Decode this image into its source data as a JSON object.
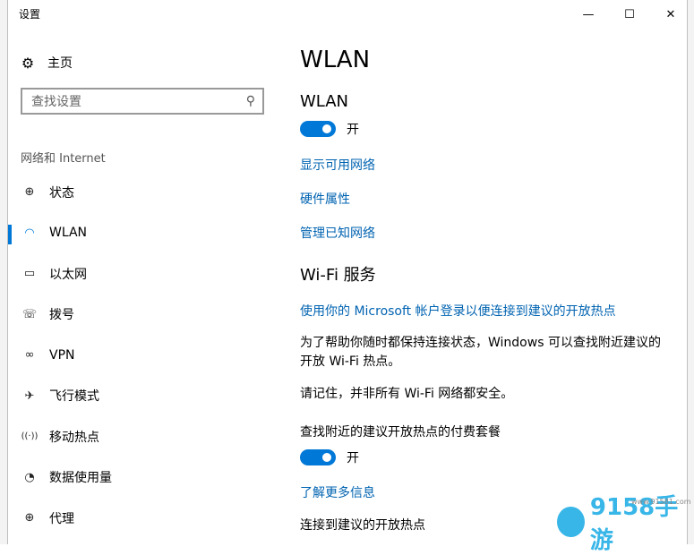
{
  "window": {
    "title": "设置",
    "minimize_glyph": "—",
    "maximize_glyph": "☐",
    "close_glyph": "✕"
  },
  "sidebar": {
    "home": {
      "label": "主页",
      "icon": "gear-icon",
      "glyph": "⚙"
    },
    "search": {
      "placeholder": "查找设置",
      "icon": "search-icon",
      "glyph": "⚲"
    },
    "section_label": "网络和 Internet",
    "items": [
      {
        "label": "状态",
        "icon": "globe-icon",
        "glyph": "⊕",
        "active": false
      },
      {
        "label": "WLAN",
        "icon": "wifi-icon",
        "glyph": "◠",
        "active": true
      },
      {
        "label": "以太网",
        "icon": "ethernet-icon",
        "glyph": "▭",
        "active": false
      },
      {
        "label": "拨号",
        "icon": "dial-up-icon",
        "glyph": "☏",
        "active": false
      },
      {
        "label": "VPN",
        "icon": "vpn-icon",
        "glyph": "∞",
        "active": false
      },
      {
        "label": "飞行模式",
        "icon": "airplane-icon",
        "glyph": "✈",
        "active": false
      },
      {
        "label": "移动热点",
        "icon": "hotspot-icon",
        "glyph": "((·))",
        "active": false
      },
      {
        "label": "数据使用量",
        "icon": "data-usage-icon",
        "glyph": "◔",
        "active": false
      },
      {
        "label": "代理",
        "icon": "proxy-icon",
        "glyph": "⊕",
        "active": false
      }
    ]
  },
  "main": {
    "page_title": "WLAN",
    "wlan_heading": "WLAN",
    "wlan_toggle": {
      "state": "开",
      "on": true
    },
    "links": [
      "显示可用网络",
      "硬件属性",
      "管理已知网络"
    ],
    "wifi_services_title": "Wi-Fi 服务",
    "microsoft_link": "使用你的 Microsoft 帐户登录以便连接到建议的开放热点",
    "desc_line1": "为了帮助你随时都保持连接状态，Windows 可以查找附近建议的",
    "desc_line2": "开放 Wi-Fi 热点。",
    "remember_text": "请记住，并非所有 Wi-Fi 网络都安全。",
    "paid_plans_label": "查找附近的建议开放热点的付费套餐",
    "paid_toggle": {
      "state": "开",
      "on": true
    },
    "learn_more_link": "了解更多信息",
    "connect_label": "连接到建议的开放热点"
  },
  "colors": {
    "accent": "#0078d7",
    "link": "#0063b1",
    "watermark": "#38b6e8"
  },
  "watermark": {
    "brand": "9158手游",
    "url": "www.91581.com"
  }
}
